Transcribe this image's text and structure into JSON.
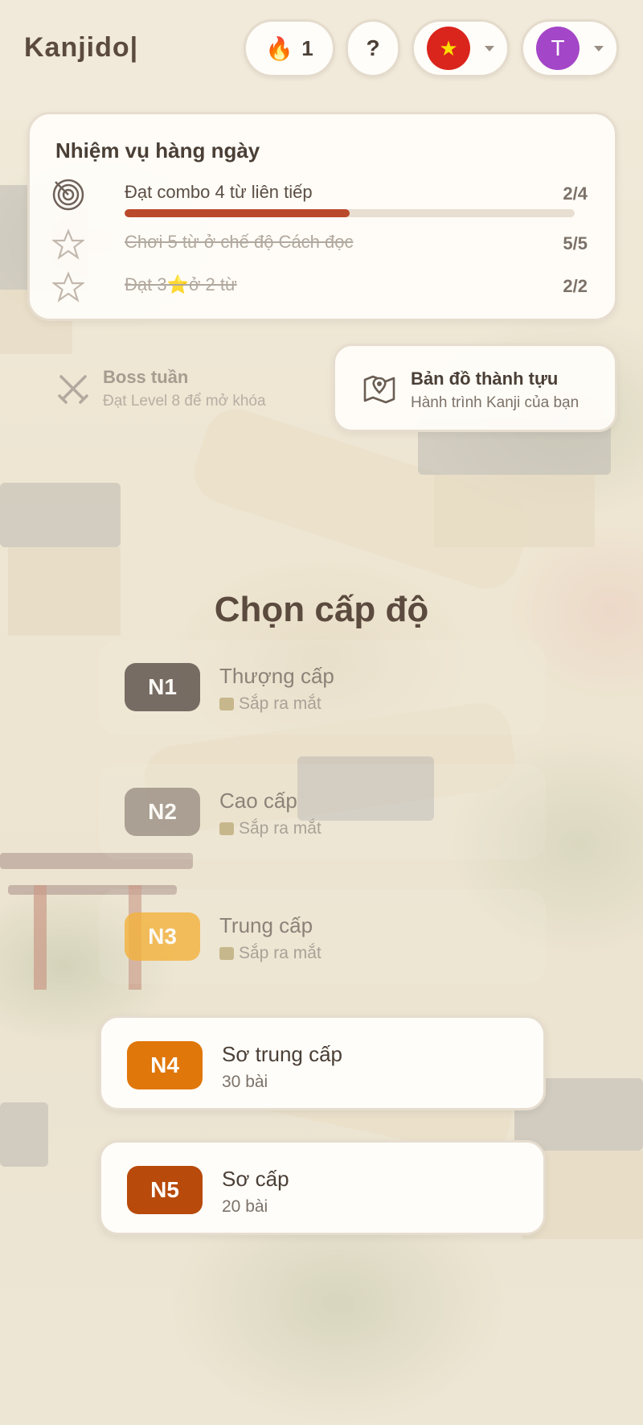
{
  "app": {
    "logo": "Kanjido|"
  },
  "header": {
    "streak_count": "1",
    "streak_icon": "flame-icon",
    "help_label": "?",
    "language": {
      "flag": "vietnam-flag",
      "flag_star": "★"
    },
    "user": {
      "avatar_letter": "T",
      "avatar_color": "#a446c8"
    }
  },
  "daily_quests": {
    "title": "Nhiệm vụ hàng ngày",
    "items": [
      {
        "text": "Đạt combo 4 từ liên tiếp",
        "count": "2/4",
        "progress": 0.5,
        "done": false,
        "icon": "target-icon"
      },
      {
        "text": "Chơi 5 từ ở chế độ Cách đọc",
        "count": "5/5",
        "progress": 1,
        "done": true,
        "icon": "star-outline-icon"
      },
      {
        "text": "Đạt 3⭐ở 2 từ",
        "count": "2/2",
        "progress": 1,
        "done": true,
        "icon": "star-outline-icon"
      }
    ]
  },
  "boss": {
    "title": "Boss tuần",
    "subtitle": "Đạt Level 8 để mở khóa",
    "icon": "crossed-swords-icon",
    "locked": true
  },
  "achievement_map": {
    "title": "Bản đồ thành tựu",
    "subtitle": "Hành trình Kanji của bạn",
    "icon": "map-pin-icon"
  },
  "levels_section": {
    "title": "Chọn cấp độ",
    "levels": [
      {
        "badge": "N1",
        "name": "Thượng cấp",
        "subtitle": "Sắp ra mắt",
        "locked": true,
        "color": "#5a4e47"
      },
      {
        "badge": "N2",
        "name": "Cao cấp",
        "subtitle": "Sắp ra mắt",
        "locked": true,
        "color": "#9a8f84"
      },
      {
        "badge": "N3",
        "name": "Trung cấp",
        "subtitle": "Sắp ra mắt",
        "locked": true,
        "color": "#f4b23c"
      },
      {
        "badge": "N4",
        "name": "Sơ trung cấp",
        "subtitle": "30 bài",
        "locked": false,
        "color": "#e0770a"
      },
      {
        "badge": "N5",
        "name": "Sơ cấp",
        "subtitle": "20 bài",
        "locked": false,
        "color": "#b84a0c"
      }
    ]
  },
  "colors": {
    "accent": "#b94a2b",
    "background": "#efe6d2",
    "card": "#fffdf9"
  }
}
